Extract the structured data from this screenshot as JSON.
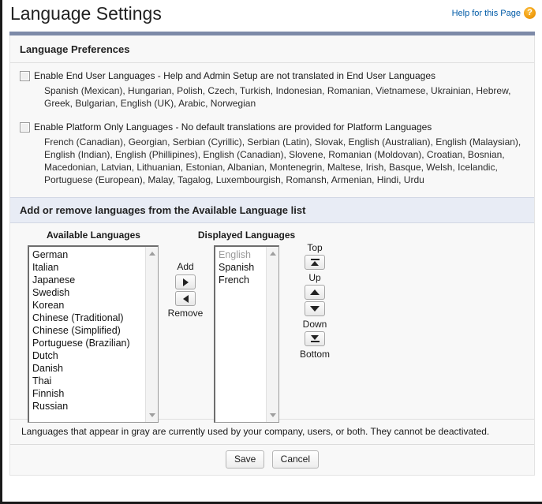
{
  "header": {
    "title": "Language Settings",
    "help_label": "Help for this Page",
    "help_icon": "question-mark-icon",
    "help_link_color": "#015ba7",
    "help_icon_color": "#f2a012"
  },
  "sections": {
    "preferences": {
      "title": "Language Preferences",
      "end_user": {
        "checkbox_checked": false,
        "label": "Enable End User Languages - Help and Admin Setup are not translated in End User Languages",
        "languages": "Spanish (Mexican), Hungarian, Polish, Czech, Turkish, Indonesian, Romanian, Vietnamese, Ukrainian, Hebrew, Greek, Bulgarian, English (UK), Arabic, Norwegian"
      },
      "platform_only": {
        "checkbox_checked": false,
        "label": "Enable Platform Only Languages - No default translations are provided for Platform Languages",
        "languages": "French (Canadian), Georgian, Serbian (Cyrillic), Serbian (Latin), Slovak, English (Australian), English (Malaysian), English (Indian), English (Phillipines), English (Canadian), Slovene, Romanian (Moldovan), Croatian, Bosnian, Macedonian, Latvian, Lithuanian, Estonian, Albanian, Montenegrin, Maltese, Irish, Basque, Welsh, Icelandic, Portuguese (European), Malay, Tagalog, Luxembourgish, Romansh, Armenian, Hindi, Urdu"
      }
    },
    "transfer": {
      "title": "Add or remove languages from the Available Language list",
      "available": {
        "heading": "Available Languages",
        "items": [
          "German",
          "Italian",
          "Japanese",
          "Swedish",
          "Korean",
          "Chinese (Traditional)",
          "Chinese (Simplified)",
          "Portuguese (Brazilian)",
          "Dutch",
          "Danish",
          "Thai",
          "Finnish",
          "Russian"
        ]
      },
      "displayed": {
        "heading": "Displayed Languages",
        "items": [
          {
            "label": "English",
            "disabled": true
          },
          {
            "label": "Spanish",
            "disabled": false
          },
          {
            "label": "French",
            "disabled": false
          }
        ]
      },
      "transfer_buttons": {
        "add_label": "Add",
        "remove_label": "Remove",
        "add_icon": "arrow-right-icon",
        "remove_icon": "arrow-left-icon"
      },
      "order_buttons": {
        "top_label": "Top",
        "up_label": "Up",
        "down_label": "Down",
        "bottom_label": "Bottom",
        "top_icon": "move-to-top-icon",
        "up_icon": "move-up-icon",
        "down_icon": "move-down-icon",
        "bottom_icon": "move-to-bottom-icon"
      }
    }
  },
  "footer": {
    "note": "Languages that appear in gray are currently used by your company, users, or both. They cannot be deactivated.",
    "save_label": "Save",
    "cancel_label": "Cancel"
  }
}
